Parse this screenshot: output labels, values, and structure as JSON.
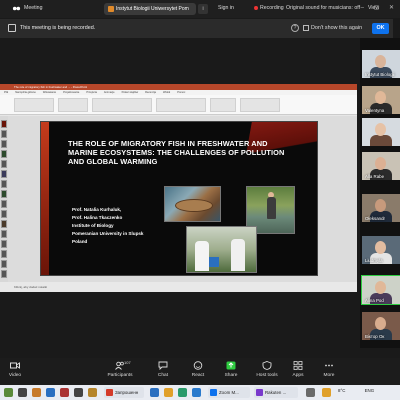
{
  "titlebar": {
    "app_title": "Meeting",
    "meeting_tab": "Instytut Biologii Uniwersytet Pom",
    "sign_in": "Sign in",
    "recording": "Recording",
    "original_sound": "Original sound for musicians: off",
    "view": "View",
    "window_controls": "– ▢ ✕"
  },
  "banner": {
    "message": "This meeting is being recorded.",
    "dont_show": "Don't show this again",
    "ok": "OK"
  },
  "powerpoint": {
    "window_title": "The role of migratory fish in freshwater and ... - PowerPoint",
    "tabs": [
      "Plik",
      "Narzędzia główne",
      "Wstawianie",
      "Projektowanie",
      "Przejścia",
      "Animacje",
      "Pokaz slajdów",
      "Recenzja",
      "Widok",
      "Pomoc"
    ],
    "status": "Kliknij, aby dodać notatki"
  },
  "slide": {
    "title": "THE ROLE OF MIGRATORY FISH IN FRESHWATER AND MARINE ECOSYSTEMS: THE CHALLENGES OF POLLUTION AND GLOBAL WARMING",
    "authors": [
      "Prof. Natalia Kurhaluk,",
      "Prof. Halina Tkaczenko",
      "Institute of Biology",
      "Pomeranian University in Slupsk",
      "Poland"
    ]
  },
  "participants": [
    {
      "name": "Instytut Biologii"
    },
    {
      "name": "Valentyna"
    },
    {
      "name": ""
    },
    {
      "name": "Alla Rabe"
    },
    {
      "name": "Oleksandr"
    },
    {
      "name": "Liudmyla"
    },
    {
      "name": "Alina Pod"
    },
    {
      "name": "Віктор Ок"
    }
  ],
  "toolbar": {
    "video": "Video",
    "participants": "Participants",
    "participant_count": "107",
    "chat": "Chat",
    "react": "React",
    "share": "Share",
    "host_tools": "Host tools",
    "apps": "Apps",
    "more": "More"
  },
  "taskbar": {
    "windows": [
      "Запрошенн",
      "Zoom M...",
      "Rakuten ..."
    ],
    "temperature": "8°C",
    "language": "ENG"
  }
}
